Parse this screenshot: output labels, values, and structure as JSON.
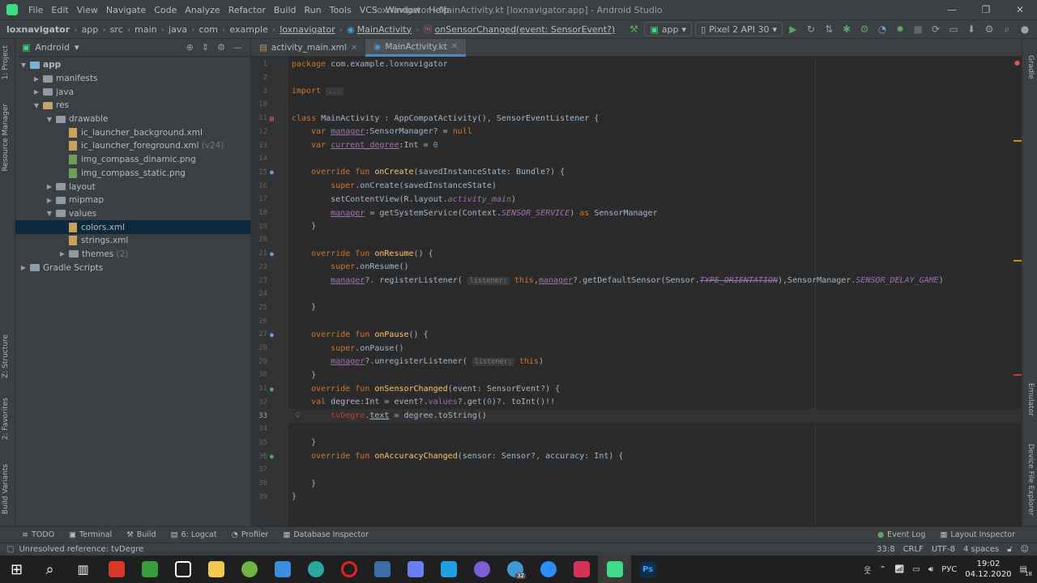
{
  "window": {
    "title": "loxnavigator - MainActivity.kt [loxnavigator.app] - Android Studio",
    "menus": [
      "File",
      "Edit",
      "View",
      "Navigate",
      "Code",
      "Analyze",
      "Refactor",
      "Build",
      "Run",
      "Tools",
      "VCS",
      "Window",
      "Help"
    ]
  },
  "breadcrumb": [
    "loxnavigator",
    "app",
    "src",
    "main",
    "java",
    "com",
    "example",
    "loxnavigator",
    "MainActivity",
    "onSensorChanged(event: SensorEvent?)"
  ],
  "toolbar": {
    "run_config": "app",
    "device": "Pixel 2 API 30"
  },
  "project_panel": {
    "view": "Android",
    "tree": [
      {
        "label": "app",
        "type": "app",
        "depth": 0,
        "open": true
      },
      {
        "label": "manifests",
        "type": "folder",
        "depth": 1,
        "open": false
      },
      {
        "label": "java",
        "type": "folder",
        "depth": 1,
        "open": false
      },
      {
        "label": "res",
        "type": "res",
        "depth": 1,
        "open": true
      },
      {
        "label": "drawable",
        "type": "folder",
        "depth": 2,
        "open": true
      },
      {
        "label": "ic_launcher_background.xml",
        "type": "xml",
        "depth": 3
      },
      {
        "label": "ic_launcher_foreground.xml",
        "type": "xml",
        "depth": 3,
        "suffix": "(v24)"
      },
      {
        "label": "img_compass_dinamic.png",
        "type": "png",
        "depth": 3
      },
      {
        "label": "img_compass_static.png",
        "type": "png",
        "depth": 3
      },
      {
        "label": "layout",
        "type": "folder",
        "depth": 2,
        "open": false
      },
      {
        "label": "mipmap",
        "type": "folder",
        "depth": 2,
        "open": false
      },
      {
        "label": "values",
        "type": "folder",
        "depth": 2,
        "open": true
      },
      {
        "label": "colors.xml",
        "type": "xml",
        "depth": 3,
        "selected": true
      },
      {
        "label": "strings.xml",
        "type": "xml",
        "depth": 3
      },
      {
        "label": "themes",
        "type": "folder",
        "depth": 3,
        "open": false,
        "suffix": "(2)"
      },
      {
        "label": "Gradle Scripts",
        "type": "gradle",
        "depth": 0,
        "open": false
      }
    ]
  },
  "left_strip": [
    "1: Project",
    "Resource Manager",
    "Z: Structure",
    "2: Favorites",
    "Build Variants"
  ],
  "right_strip": [
    "Gradle",
    "Emulator",
    "Device File Explorer"
  ],
  "tabs": [
    {
      "label": "activity_main.xml",
      "active": false
    },
    {
      "label": "MainActivity.kt",
      "active": true
    }
  ],
  "editor": {
    "current_line": 33,
    "lines": [
      {
        "n": "1",
        "html": "<span class='k'>package</span> com.example.loxnavigator"
      },
      {
        "n": "2",
        "html": ""
      },
      {
        "n": "3",
        "html": "<span class='k'>import</span> <span class='hint'>...</span>"
      },
      {
        "n": "10",
        "html": ""
      },
      {
        "n": "11",
        "html": "<span class='k'>class</span> MainActivity : AppCompatActivity(), SensorEventListener {"
      },
      {
        "n": "12",
        "html": "    <span class='k'>var</span> <span class='p u'>manager</span>:SensorManager? = <span class='k'>null</span>"
      },
      {
        "n": "13",
        "html": "    <span class='k'>var</span> <span class='p u'>current_degree</span>:Int = <span class='n'>0</span>"
      },
      {
        "n": "14",
        "html": ""
      },
      {
        "n": "15",
        "html": "    <span class='k'>override fun</span> <span class='f'>onCreate</span>(savedInstanceState: Bundle?) {"
      },
      {
        "n": "16",
        "html": "        <span class='k'>super</span>.onCreate(savedInstanceState)"
      },
      {
        "n": "17",
        "html": "        setContentView(R.layout.<span class='p i'>activity_main</span>)"
      },
      {
        "n": "18",
        "html": "        <span class='p u'>manager</span> = getSystemService(Context.<span class='p i'>SENSOR_SERVICE</span>) <span class='k'>as</span> SensorManager"
      },
      {
        "n": "19",
        "html": "    }"
      },
      {
        "n": "20",
        "html": ""
      },
      {
        "n": "21",
        "html": "    <span class='k'>override fun</span> <span class='f'>onResume</span>() {"
      },
      {
        "n": "22",
        "html": "        <span class='k'>super</span>.onResume()"
      },
      {
        "n": "23",
        "html": "        <span class='p u'>manager</span>?. registerListener( <span class='hint'>listener:</span> <span class='k'>this</span>,<span class='p u'>manager</span>?.getDefaultSensor(Sensor.<span class='p i st'>TYPE_ORIENTATION</span>),SensorManager.<span class='p i'>SENSOR_DELAY_GAME</span>)"
      },
      {
        "n": "24",
        "html": ""
      },
      {
        "n": "25",
        "html": "    }"
      },
      {
        "n": "26",
        "html": ""
      },
      {
        "n": "27",
        "html": "    <span class='k'>override fun</span> <span class='f'>onPause</span>() {"
      },
      {
        "n": "28",
        "html": "        <span class='k'>super</span>.onPause()"
      },
      {
        "n": "29",
        "html": "        <span class='p u'>manager</span>?.unregisterListener( <span class='hint'>listener:</span> <span class='k'>this</span>)"
      },
      {
        "n": "30",
        "html": "    }"
      },
      {
        "n": "31",
        "html": "    <span class='k'>override fun</span> <span class='f'>onSensorChanged</span>(event: SensorEvent?) {"
      },
      {
        "n": "32",
        "html": "    <span class='k'>val</span> degree:Int = event?.<span class='p'>values</span>?.get(<span class='n'>0</span>)?. toInt()!!"
      },
      {
        "n": "33",
        "html": "        <span class='r'>tvDegre</span>.<span class='u'>text</span> = degree.toString()"
      },
      {
        "n": "34",
        "html": ""
      },
      {
        "n": "35",
        "html": "    }"
      },
      {
        "n": "36",
        "html": "    <span class='k'>override fun</span> <span class='f'>onAccuracyChanged</span>(sensor: Sensor?, accuracy: Int) {"
      },
      {
        "n": "37",
        "html": ""
      },
      {
        "n": "38",
        "html": "    }"
      },
      {
        "n": "39",
        "html": "}"
      }
    ]
  },
  "bottom_tools": [
    "TODO",
    "Terminal",
    "Build",
    "6: Logcat",
    "Profiler",
    "Database Inspector"
  ],
  "bottom_tools_right": [
    "Event Log",
    "Layout Inspector"
  ],
  "status": {
    "message": "Unresolved reference: tvDegre",
    "position": "33:8",
    "line_sep": "CRLF",
    "encoding": "UTF-8",
    "indent": "4 spaces"
  },
  "taskbar": {
    "apps": [
      {
        "name": "start",
        "color": "#ffffff"
      },
      {
        "name": "search",
        "color": "#ffffff"
      },
      {
        "name": "task-view",
        "color": "#ffffff"
      },
      {
        "name": "app-red",
        "color": "#d9372b"
      },
      {
        "name": "app-multi",
        "color": "#3a9b3a"
      },
      {
        "name": "store",
        "color": "#ffffff"
      },
      {
        "name": "explorer",
        "color": "#f2c94c"
      },
      {
        "name": "torrent",
        "color": "#71b043"
      },
      {
        "name": "mail",
        "color": "#3b8ddd"
      },
      {
        "name": "edge",
        "color": "#2aa8a0"
      },
      {
        "name": "opera",
        "color": "#e0242c"
      },
      {
        "name": "steam",
        "color": "#3a6ea5"
      },
      {
        "name": "discord",
        "color": "#6b7ff0"
      },
      {
        "name": "skype",
        "color": "#1fa0e0"
      },
      {
        "name": "viber",
        "color": "#7b5fd6"
      },
      {
        "name": "telegram",
        "color": "#3d9ad6"
      },
      {
        "name": "zoom",
        "color": "#2d8cff"
      },
      {
        "name": "jetbrains",
        "color": "#d6325c"
      },
      {
        "name": "android-studio",
        "color": "#3ddc84"
      },
      {
        "name": "photoshop",
        "color": "#0f2d4e"
      }
    ],
    "telegram_badge": "32",
    "language": "РУС",
    "time": "19:02",
    "date": "04.12.2020",
    "notifications": "18"
  }
}
